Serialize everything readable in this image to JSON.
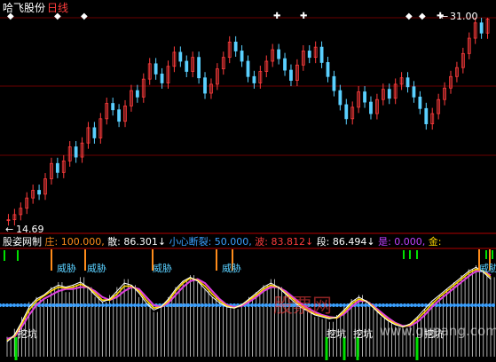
{
  "header": {
    "stock_name": "哈飞股份",
    "period": "日线"
  },
  "price_panel": {
    "high_label": "31.00",
    "low_label": "14.69",
    "high_arrow": "←",
    "low_arrow": "←",
    "marker_glyph": "◆",
    "marker_glyph_alt": "✚"
  },
  "indicator_bar": {
    "name": "股姿网制",
    "items": [
      {
        "label": "庄:",
        "value": "100.000,",
        "color": "#ff8c1a"
      },
      {
        "label": "散:",
        "value": "86.301↓",
        "color": "#ffffff"
      },
      {
        "label": "小心断裂:",
        "value": "50.000,",
        "color": "#3aa0ff"
      },
      {
        "label": "波:",
        "value": "83.812↓",
        "color": "#ff3c3c"
      },
      {
        "label": "段:",
        "value": "86.494↓",
        "color": "#ffffff"
      },
      {
        "label": "是:",
        "value": "0.000,",
        "color": "#c040ff"
      },
      {
        "label": "金:",
        "value": "",
        "color": "#ffd700"
      }
    ]
  },
  "annotations": {
    "danger": "威胁",
    "dig": "挖坑"
  },
  "watermark": {
    "cn": "股票网",
    "en": "www.gupang.com"
  },
  "colors": {
    "background": "#000000",
    "up_candle": "#ff3c3c",
    "down_candle": "#5ad0ff",
    "divider": "#b00000",
    "white_line": "#ffffff",
    "magenta_line": "#e040e0",
    "yellow_line": "#ffd700",
    "dots": "#3aa0ff",
    "green": "#00e000",
    "orange": "#ff8c1a"
  },
  "chart_data": [
    {
      "type": "candlestick",
      "title": "哈飞股份 日线",
      "ylim": [
        14.69,
        31.0
      ],
      "close": [
        15.2,
        15.6,
        16.1,
        16.9,
        17.5,
        17.2,
        18.4,
        19.6,
        18.9,
        19.8,
        20.9,
        20.1,
        21.2,
        22.4,
        21.6,
        23.1,
        24.3,
        23.8,
        22.9,
        24.1,
        25.3,
        24.8,
        26.2,
        27.4,
        26.6,
        25.9,
        27.2,
        28.3,
        27.6,
        26.8,
        27.9,
        26.3,
        25.1,
        25.8,
        27.0,
        27.9,
        29.1,
        28.4,
        27.6,
        26.4,
        25.9,
        26.8,
        27.6,
        28.5,
        27.8,
        26.9,
        26.1,
        27.3,
        28.4,
        27.9,
        28.7,
        27.5,
        26.4,
        25.3,
        24.2,
        23.1,
        24.0,
        25.2,
        24.4,
        23.5,
        24.6,
        25.4,
        24.7,
        25.8,
        26.3,
        25.6,
        24.8,
        23.9,
        22.7,
        23.5,
        24.6,
        25.5,
        26.4,
        27.1,
        28.2,
        29.4,
        30.6,
        29.8,
        30.9
      ]
    },
    {
      "type": "line",
      "title": "股姿网制",
      "series": [
        {
          "name": "庄",
          "latest": 100.0
        },
        {
          "name": "散",
          "latest": 86.301
        },
        {
          "name": "小心断裂",
          "latest": 50.0
        },
        {
          "name": "波",
          "latest": 83.812
        },
        {
          "name": "段",
          "latest": 86.494
        },
        {
          "name": "是",
          "latest": 0.0
        }
      ],
      "ylim": [
        0,
        100
      ],
      "histogram": [
        20,
        28,
        40,
        55,
        60,
        58,
        70,
        75,
        65,
        72,
        80,
        70,
        60,
        55,
        62,
        70,
        78,
        72,
        60,
        50,
        45,
        52,
        60,
        70,
        76,
        82,
        75,
        68,
        60,
        55,
        50,
        48,
        52,
        60,
        65,
        72,
        78,
        70,
        62,
        55,
        50,
        45,
        40,
        38,
        35,
        42,
        50,
        58,
        62,
        55,
        48,
        40,
        35,
        30,
        28,
        32,
        40,
        48,
        55,
        62,
        68,
        75,
        82,
        88,
        92,
        86,
        80
      ],
      "white_line": [
        15,
        22,
        35,
        50,
        58,
        62,
        68,
        72,
        70,
        72,
        75,
        70,
        62,
        55,
        58,
        66,
        74,
        72,
        64,
        54,
        47,
        50,
        58,
        68,
        76,
        80,
        76,
        68,
        60,
        54,
        50,
        49,
        52,
        58,
        64,
        70,
        74,
        70,
        63,
        56,
        50,
        46,
        42,
        40,
        38,
        40,
        47,
        55,
        60,
        56,
        49,
        42,
        36,
        32,
        30,
        33,
        40,
        48,
        56,
        62,
        68,
        74,
        80,
        86,
        90,
        85,
        78
      ],
      "magenta_line": [
        18,
        20,
        30,
        42,
        52,
        58,
        62,
        66,
        68,
        68,
        70,
        70,
        66,
        60,
        57,
        60,
        66,
        70,
        68,
        60,
        52,
        50,
        54,
        62,
        70,
        76,
        78,
        74,
        66,
        58,
        52,
        50,
        51,
        55,
        60,
        66,
        70,
        70,
        66,
        60,
        54,
        49,
        45,
        42,
        40,
        39,
        43,
        50,
        56,
        56,
        51,
        45,
        39,
        34,
        31,
        31,
        35,
        42,
        50,
        57,
        63,
        69,
        75,
        81,
        86,
        86,
        82
      ],
      "yellow_line": [
        16,
        21,
        33,
        47,
        56,
        61,
        66,
        70,
        69,
        70,
        73,
        70,
        64,
        57,
        57,
        63,
        71,
        71,
        66,
        57,
        49,
        50,
        56,
        66,
        74,
        79,
        77,
        71,
        63,
        56,
        51,
        49,
        52,
        57,
        62,
        68,
        72,
        70,
        64,
        58,
        52,
        47,
        43,
        41,
        39,
        39,
        45,
        53,
        58,
        56,
        50,
        43,
        37,
        33,
        30,
        32,
        38,
        45,
        53,
        60,
        66,
        72,
        78,
        84,
        88,
        86,
        80
      ]
    }
  ]
}
